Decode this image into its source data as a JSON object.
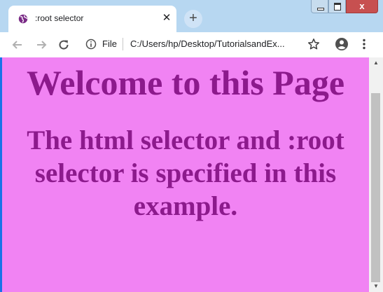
{
  "browser": {
    "tab": {
      "title": ":root selector",
      "close_glyph": "✕"
    },
    "new_tab_glyph": "+",
    "window_controls": {
      "close_glyph": "x"
    },
    "omnibox": {
      "scheme_label": "File",
      "url": "C:/Users/hp/Desktop/TutorialsandEx..."
    },
    "icons": [
      "globe-icon",
      "back-arrow-icon",
      "forward-arrow-icon",
      "reload-icon",
      "info-icon",
      "star-icon",
      "profile-icon",
      "menu-icon"
    ],
    "colors": {
      "titlebar": "#b7d7f1",
      "accent": "#1a73e8"
    }
  },
  "page": {
    "heading": "Welcome to this Page",
    "subheading": "The html selector and :root selector is specified in this example.",
    "colors": {
      "background": "#f183f3",
      "text": "#8c1a8c"
    }
  },
  "scrollbar": {
    "up_glyph": "▲",
    "down_glyph": "▼"
  }
}
